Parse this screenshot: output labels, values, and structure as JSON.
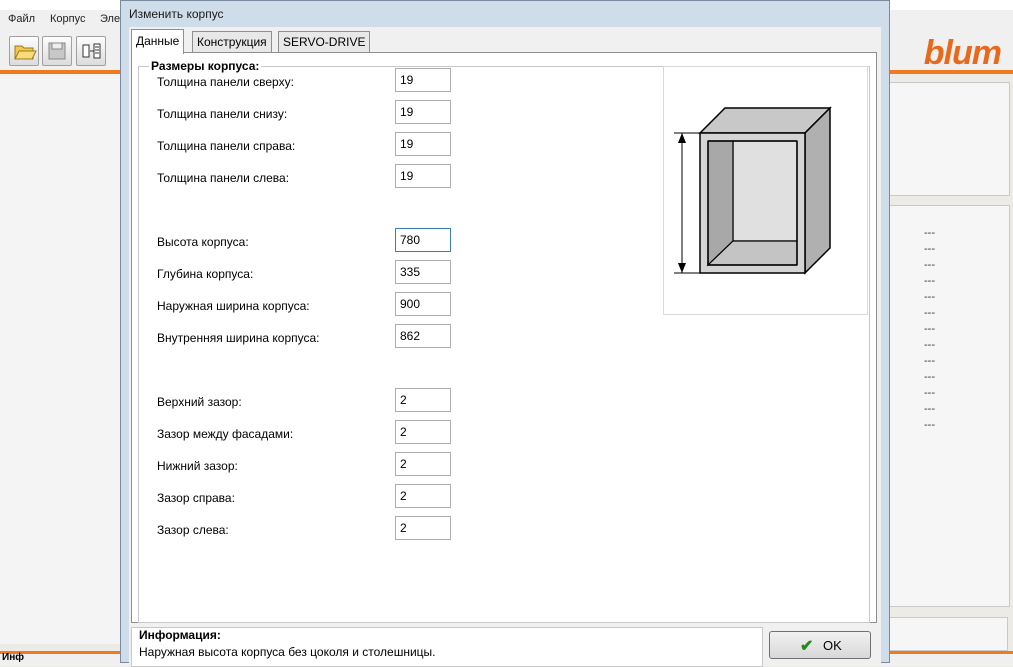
{
  "menu": [
    "Файл",
    "Корпус",
    "Эле"
  ],
  "logo": "blum",
  "status_text": "Инф",
  "right_values": [
    "---",
    "---",
    "---",
    "---",
    "---",
    "---",
    "---",
    "---",
    "---",
    "---",
    "---",
    "---",
    "---"
  ],
  "dialog": {
    "title": "Изменить корпус",
    "tabs": [
      "Данные",
      "Конструкция",
      "SERVO-DRIVE"
    ],
    "group_title": "Размеры корпуса:",
    "fields": [
      {
        "label": "Толщина панели сверху:",
        "value": "19"
      },
      {
        "label": "Толщина панели снизу:",
        "value": "19"
      },
      {
        "label": "Толщина панели справа:",
        "value": "19"
      },
      {
        "label": "Толщина панели слева:",
        "value": "19"
      },
      {
        "label": "Высота корпуса:",
        "value": "780"
      },
      {
        "label": "Глубина корпуса:",
        "value": "335"
      },
      {
        "label": "Наружная ширина корпуса:",
        "value": "900"
      },
      {
        "label": "Внутренняя ширина корпуса:",
        "value": "862"
      },
      {
        "label": "Верхний зазор:",
        "value": "2"
      },
      {
        "label": "Зазор между фасадами:",
        "value": "2"
      },
      {
        "label": "Нижний зазор:",
        "value": "2"
      },
      {
        "label": "Зазор справа:",
        "value": "2"
      },
      {
        "label": "Зазор слева:",
        "value": "2"
      }
    ],
    "info_title": "Информация:",
    "info_text": "Наружная высота корпуса без цоколя и столешницы.",
    "ok_label": "OK"
  }
}
